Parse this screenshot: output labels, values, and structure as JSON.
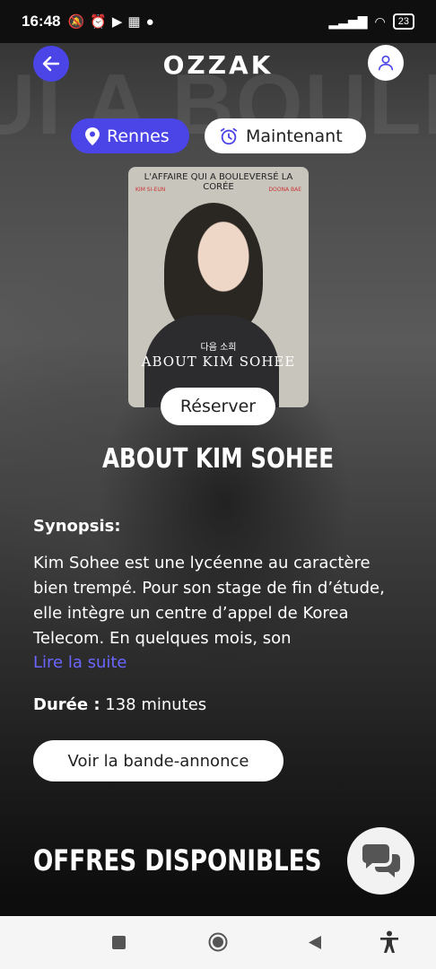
{
  "status": {
    "time": "16:48",
    "battery": "23"
  },
  "header": {
    "logo": "OZZAK",
    "bg_text": "UI A BOULEVERS"
  },
  "filters": {
    "city": "Rennes",
    "time": "Maintenant"
  },
  "poster": {
    "tagline": "L'AFFAIRE QUI A BOULEVERSÉ LA CORÉE",
    "actor_left": "KIM SI-EUN",
    "actor_right": "DOONA BAE",
    "korean_title": "다음 소희",
    "title": "ABOUT KIM SOHEE"
  },
  "movie": {
    "reserve_label": "Réserver",
    "title": "ABOUT KIM SOHEE",
    "synopsis_label": "Synopsis:",
    "synopsis": "Kim Sohee est une lycéenne au caractère bien trempé. Pour son stage de fin d’étude, elle intègre un centre d’appel de Korea Telecom. En quelques mois, son",
    "read_more": "Lire la suite",
    "duration_label": "Durée :",
    "duration_value": "138 minutes",
    "trailer_label": "Voir la bande-annonce"
  },
  "offers": {
    "heading": "OFFRES DISPONIBLES"
  },
  "colors": {
    "accent": "#4b45e8",
    "link": "#6b66ff"
  }
}
